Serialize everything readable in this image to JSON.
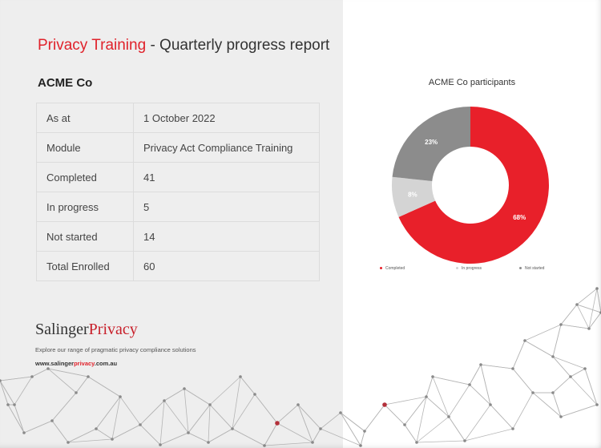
{
  "title": {
    "accent": "Privacy Training",
    "rest": " - Quarterly progress report"
  },
  "company": "ACME Co",
  "table": [
    {
      "label": "As at",
      "value": "1 October 2022"
    },
    {
      "label": "Module",
      "value": "Privacy Act Compliance Training"
    },
    {
      "label": "Completed",
      "value": "41"
    },
    {
      "label": "In progress",
      "value": "5"
    },
    {
      "label": "Not started",
      "value": "14"
    },
    {
      "label": "Total Enrolled",
      "value": "60"
    }
  ],
  "logo": {
    "part1": "Salinger",
    "part2": "Privacy"
  },
  "tagline": "Explore our range of pragmatic privacy compliance solutions",
  "website": {
    "pre": "www.salinger",
    "mid": "privacy",
    "post": ".com.au"
  },
  "chart_data": {
    "type": "pie",
    "title": "ACME Co participants",
    "categories": [
      "Completed",
      "In progress",
      "Not started"
    ],
    "values": [
      41,
      5,
      14
    ],
    "percent_labels": [
      "68%",
      "8%",
      "23%"
    ],
    "colors": [
      "#e8202a",
      "#d4d4d4",
      "#8c8c8c"
    ],
    "legend_position": "bottom"
  },
  "colors": {
    "accent": "#e0222b",
    "panel": "#eeeeee"
  }
}
